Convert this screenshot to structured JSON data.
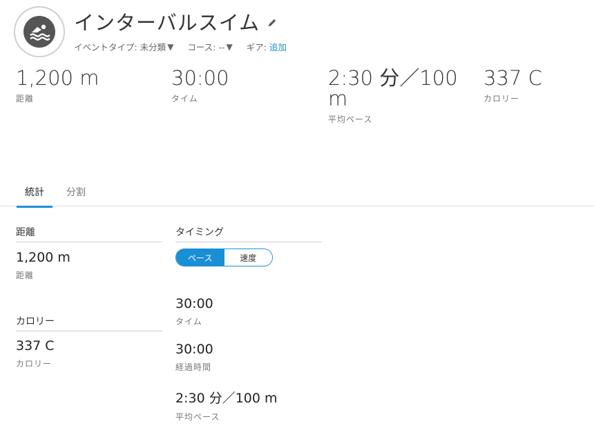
{
  "activity": {
    "title": "インターバルスイム",
    "meta": {
      "event_type_label": "イベントタイプ: 未分類",
      "course_label": "コース: --",
      "gear_label": "ギア:",
      "gear_link": "追加",
      "caret": "▼"
    }
  },
  "summary": [
    {
      "value": "1,200 m",
      "label": "距離"
    },
    {
      "value": "30:00",
      "label": "タイム"
    },
    {
      "value_line1": "2:30 分／100",
      "value_line2": "m",
      "label": "平均ペース"
    },
    {
      "value": "337 C",
      "label": "カロリー"
    }
  ],
  "tabs": [
    {
      "label": "統計"
    },
    {
      "label": "分割"
    }
  ],
  "stats": {
    "distance": {
      "header": "距離",
      "value": "1,200 m",
      "label": "距離"
    },
    "calories": {
      "header": "カロリー",
      "value": "337 C",
      "label": "カロリー"
    },
    "timing": {
      "header": "タイミング",
      "toggle": {
        "pace": "ペース",
        "speed": "速度",
        "selected": "pace"
      },
      "items": [
        {
          "value": "30:00",
          "label": "タイム"
        },
        {
          "value": "30:00",
          "label": "経過時間"
        },
        {
          "value": "2:30 分／100 m",
          "label": "平均ペース"
        }
      ]
    }
  },
  "colors": {
    "accent": "#1a8fd6",
    "icon_bg": "#555555"
  },
  "icons": {
    "activity": "swimmer-icon",
    "edit": "pencil-icon"
  }
}
